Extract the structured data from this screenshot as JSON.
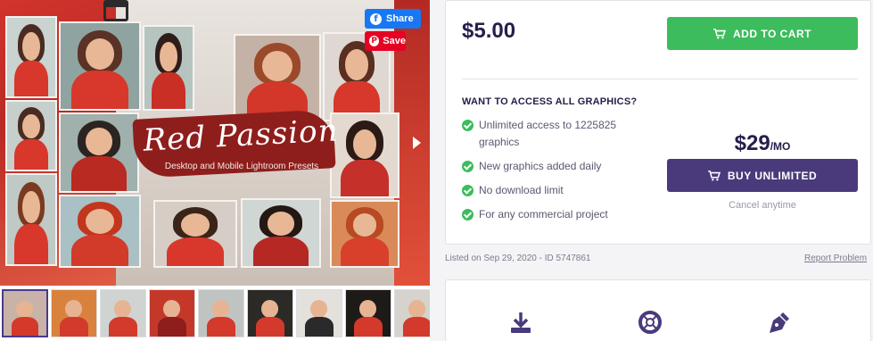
{
  "gallery": {
    "hero_title": "Red Passion",
    "hero_subtitle": "Desktop and Mobile Lightroom Presets",
    "share_label": "Share",
    "save_label": "Save",
    "thumbnail_count": 9
  },
  "product": {
    "price": "$5.00",
    "add_to_cart_label": "ADD TO CART"
  },
  "subscription": {
    "heading": "WANT TO ACCESS ALL GRAPHICS?",
    "benefits": [
      "Unlimited access to 1225825 graphics",
      "New graphics added daily",
      "No download limit",
      "For any commercial project"
    ],
    "price_amount": "$29",
    "price_period": "/MO",
    "buy_label": "BUY UNLIMITED",
    "cancel_note": "Cancel anytime"
  },
  "listing": {
    "meta": "Listed on Sep 29, 2020 - ID 5747861",
    "report_label": "Report Problem"
  },
  "features": {
    "icons": [
      "download-icon",
      "support-lifebuoy-icon",
      "pen-nib-icon"
    ]
  },
  "colors": {
    "accent_green": "#3cbc5c",
    "accent_purple": "#4a3a7c",
    "text_dark": "#24204a",
    "facebook_blue": "#1877f2",
    "pinterest_red": "#e60023"
  }
}
